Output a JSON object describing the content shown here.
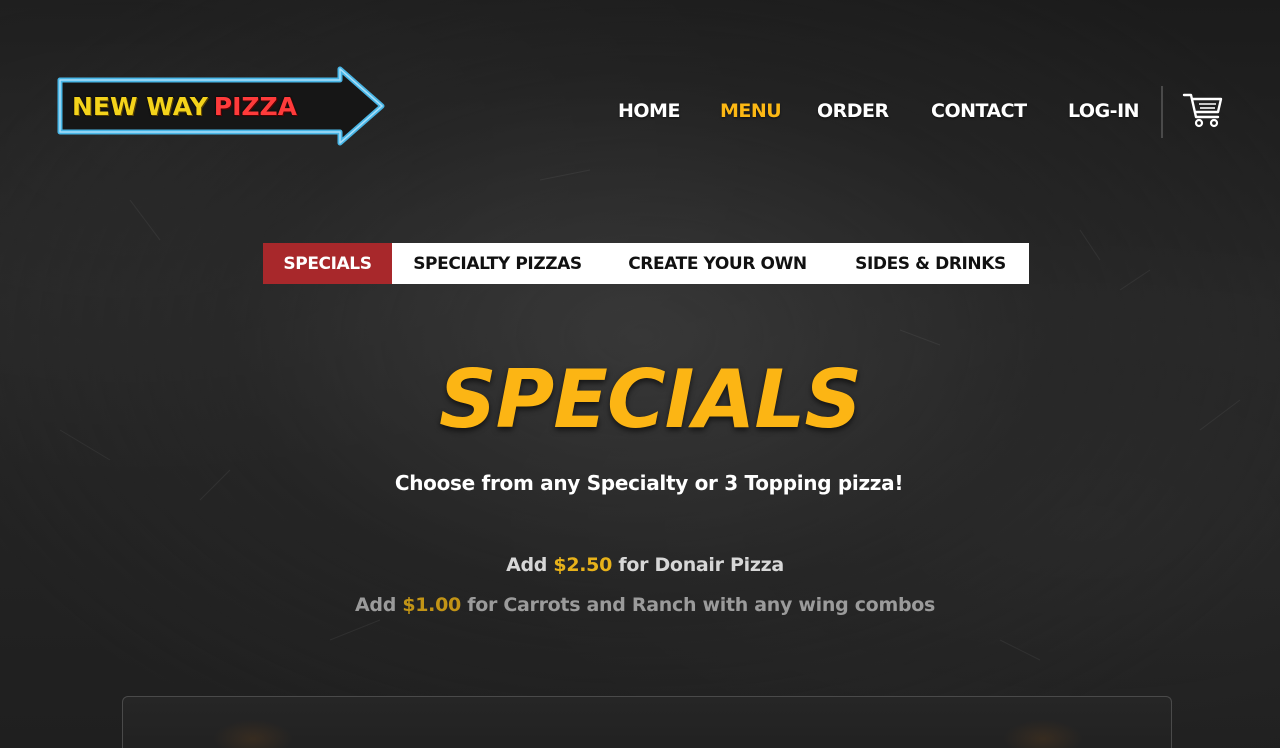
{
  "brand": {
    "logo_word1": "NEW WAY",
    "logo_word2": "PIZZA",
    "colors": {
      "logo_yellow": "#f4d31b",
      "logo_red": "#ff3b3b",
      "logo_arrow_border": "#49b6e6",
      "accent_orange": "#fcb514",
      "tab_active_red": "#a8282b",
      "price_gold": "#e8b21a"
    }
  },
  "nav": {
    "items": [
      {
        "label": "HOME",
        "active": false
      },
      {
        "label": "MENU",
        "active": true
      },
      {
        "label": "ORDER",
        "active": false
      },
      {
        "label": "CONTACT",
        "active": false
      },
      {
        "label": "LOG-IN",
        "active": false
      }
    ],
    "cart_icon": "shopping-cart-icon"
  },
  "tabs": [
    {
      "label": "SPECIALS",
      "active": true
    },
    {
      "label": "SPECIALTY PIZZAS",
      "active": false
    },
    {
      "label": "CREATE YOUR OWN",
      "active": false
    },
    {
      "label": "SIDES & DRINKS",
      "active": false
    }
  ],
  "hero": {
    "title": "SPECIALS",
    "subtitle": "Choose from any Specialty or 3 Topping pizza!"
  },
  "addons": [
    {
      "prefix": "Add",
      "price": "$2.50",
      "suffix": "for Donair Pizza"
    },
    {
      "prefix": "Add",
      "price": "$1.00",
      "suffix": "for Carrots and Ranch with any wing combos"
    }
  ]
}
